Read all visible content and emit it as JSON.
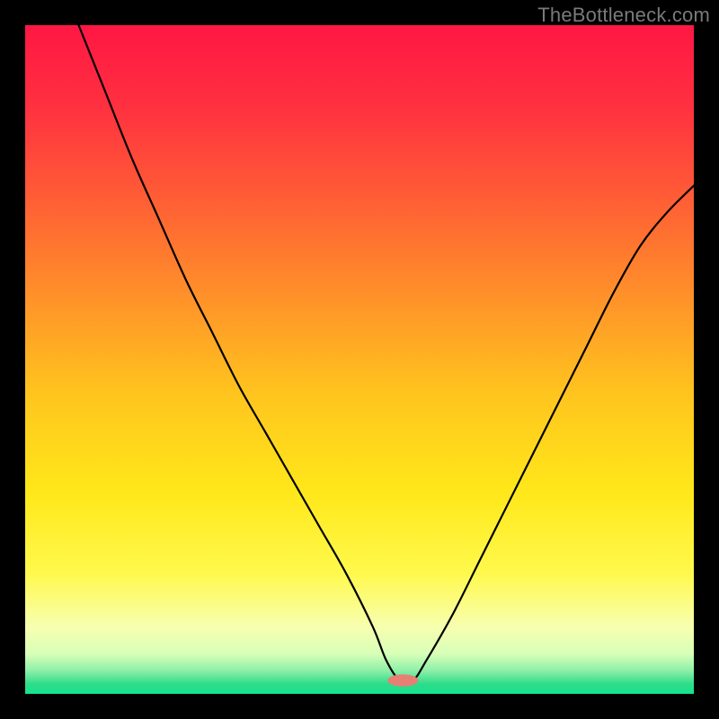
{
  "watermark": "TheBottleneck.com",
  "chart_data": {
    "type": "line",
    "title": "",
    "xlabel": "",
    "ylabel": "",
    "xlim": [
      0,
      100
    ],
    "ylim": [
      0,
      100
    ],
    "grid": false,
    "series": [
      {
        "name": "curve",
        "x": [
          8,
          12,
          16,
          20,
          24,
          28,
          32,
          36,
          40,
          44,
          48,
          52,
          54,
          56,
          58,
          60,
          64,
          68,
          72,
          76,
          80,
          84,
          88,
          92,
          96,
          100
        ],
        "y": [
          100,
          90,
          80,
          71,
          62,
          54,
          46,
          39,
          32,
          25,
          18,
          10,
          5,
          2,
          2,
          5,
          12,
          20,
          28,
          36,
          44,
          52,
          60,
          67,
          72,
          76
        ]
      }
    ],
    "marker": {
      "x": 56.5,
      "y": 2,
      "rx": 2.3,
      "ry": 0.9,
      "color": "#e77f74"
    },
    "gradient_stops": [
      {
        "t": 0.0,
        "color": "#ff1744"
      },
      {
        "t": 0.12,
        "color": "#ff3040"
      },
      {
        "t": 0.25,
        "color": "#ff5a36"
      },
      {
        "t": 0.4,
        "color": "#ff8f2a"
      },
      {
        "t": 0.55,
        "color": "#ffc41e"
      },
      {
        "t": 0.7,
        "color": "#ffe81a"
      },
      {
        "t": 0.82,
        "color": "#fff94d"
      },
      {
        "t": 0.9,
        "color": "#f7ffb0"
      },
      {
        "t": 0.94,
        "color": "#d8ffb8"
      },
      {
        "t": 0.965,
        "color": "#8ef0a8"
      },
      {
        "t": 0.985,
        "color": "#2fdc8a"
      },
      {
        "t": 1.0,
        "color": "#15e38f"
      }
    ]
  }
}
